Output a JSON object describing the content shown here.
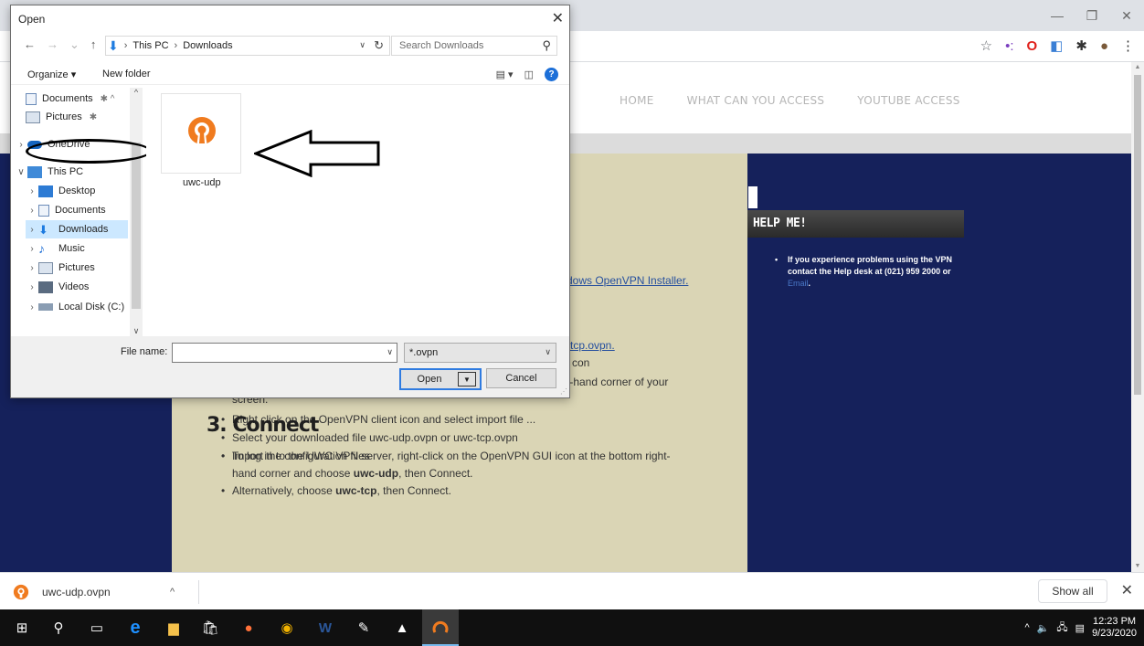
{
  "browser": {
    "window_controls": {
      "minimize": "—",
      "restore": "❐",
      "close": "✕"
    },
    "toolbar_icons": [
      "star-icon",
      "extension-dots-icon",
      "opera-icon",
      "extension-icon",
      "puzzle-icon",
      "profile-avatar-icon",
      "menu-dots-icon"
    ]
  },
  "page": {
    "nav": [
      "HOME",
      "WHAT CAN YOU ACCESS",
      "YOUTUBE ACCESS"
    ],
    "fragment_installer": "dows OpenVPN Installer.",
    "fragment_tcp": "-tcp.ovpn.",
    "fragment_con": "con",
    "fragment_corner": "t-hand corner of your",
    "fragment_screen": "screen.",
    "steps2": [
      "Right click on the OpenVPN client icon and select import file ...",
      "Select your downloaded file uwc-udp.ovpn or uwc-tcp.ovpn",
      "Import the configuration files"
    ],
    "heading_connect": "3. Connect",
    "connect_line1": "To log in to the UWC VPN server, right-click on the OpenVPN GUI icon at the bottom right-",
    "connect_line1b_pre": "hand corner and choose ",
    "connect_line1b_bold": "uwc-udp",
    "connect_line1b_post": ", then Connect.",
    "connect_line2_pre": "Alternatively, choose ",
    "connect_line2_bold": "uwc-tcp",
    "connect_line2_post": ", then Connect.",
    "sidebar": {
      "title": "HELP ME!",
      "text": "If you experience problems using the VPN contact the Help desk at (021) 959 2000 or ",
      "email": "Email",
      "text_end": "."
    }
  },
  "downloads": {
    "file": "uwc-udp.ovpn",
    "show_all": "Show all",
    "close": "✕"
  },
  "taskbar": {
    "time": "12:23 PM",
    "date": "9/23/2020"
  },
  "dialog": {
    "title": "Open",
    "path": [
      "This PC",
      "Downloads"
    ],
    "search_placeholder": "Search Downloads",
    "organize": "Organize ▾",
    "new_folder": "New folder",
    "tree": [
      {
        "label": "Documents",
        "pinned": true
      },
      {
        "label": "Pictures",
        "pinned": true
      },
      {
        "label": "OneDrive"
      },
      {
        "label": "This PC"
      },
      {
        "label": "Desktop"
      },
      {
        "label": "Documents"
      },
      {
        "label": "Downloads"
      },
      {
        "label": "Music"
      },
      {
        "label": "Pictures"
      },
      {
        "label": "Videos"
      },
      {
        "label": "Local Disk (C:)"
      }
    ],
    "file": "uwc-udp",
    "file_name_label": "File name:",
    "file_name_value": "",
    "filter": "*.ovpn",
    "open_label": "Open",
    "cancel_label": "Cancel"
  },
  "colors": {
    "navy": "#15215b",
    "content_bg": "#dad5b5",
    "openvpn_orange": "#f07b1f",
    "accent_blue": "#1e7be0"
  }
}
